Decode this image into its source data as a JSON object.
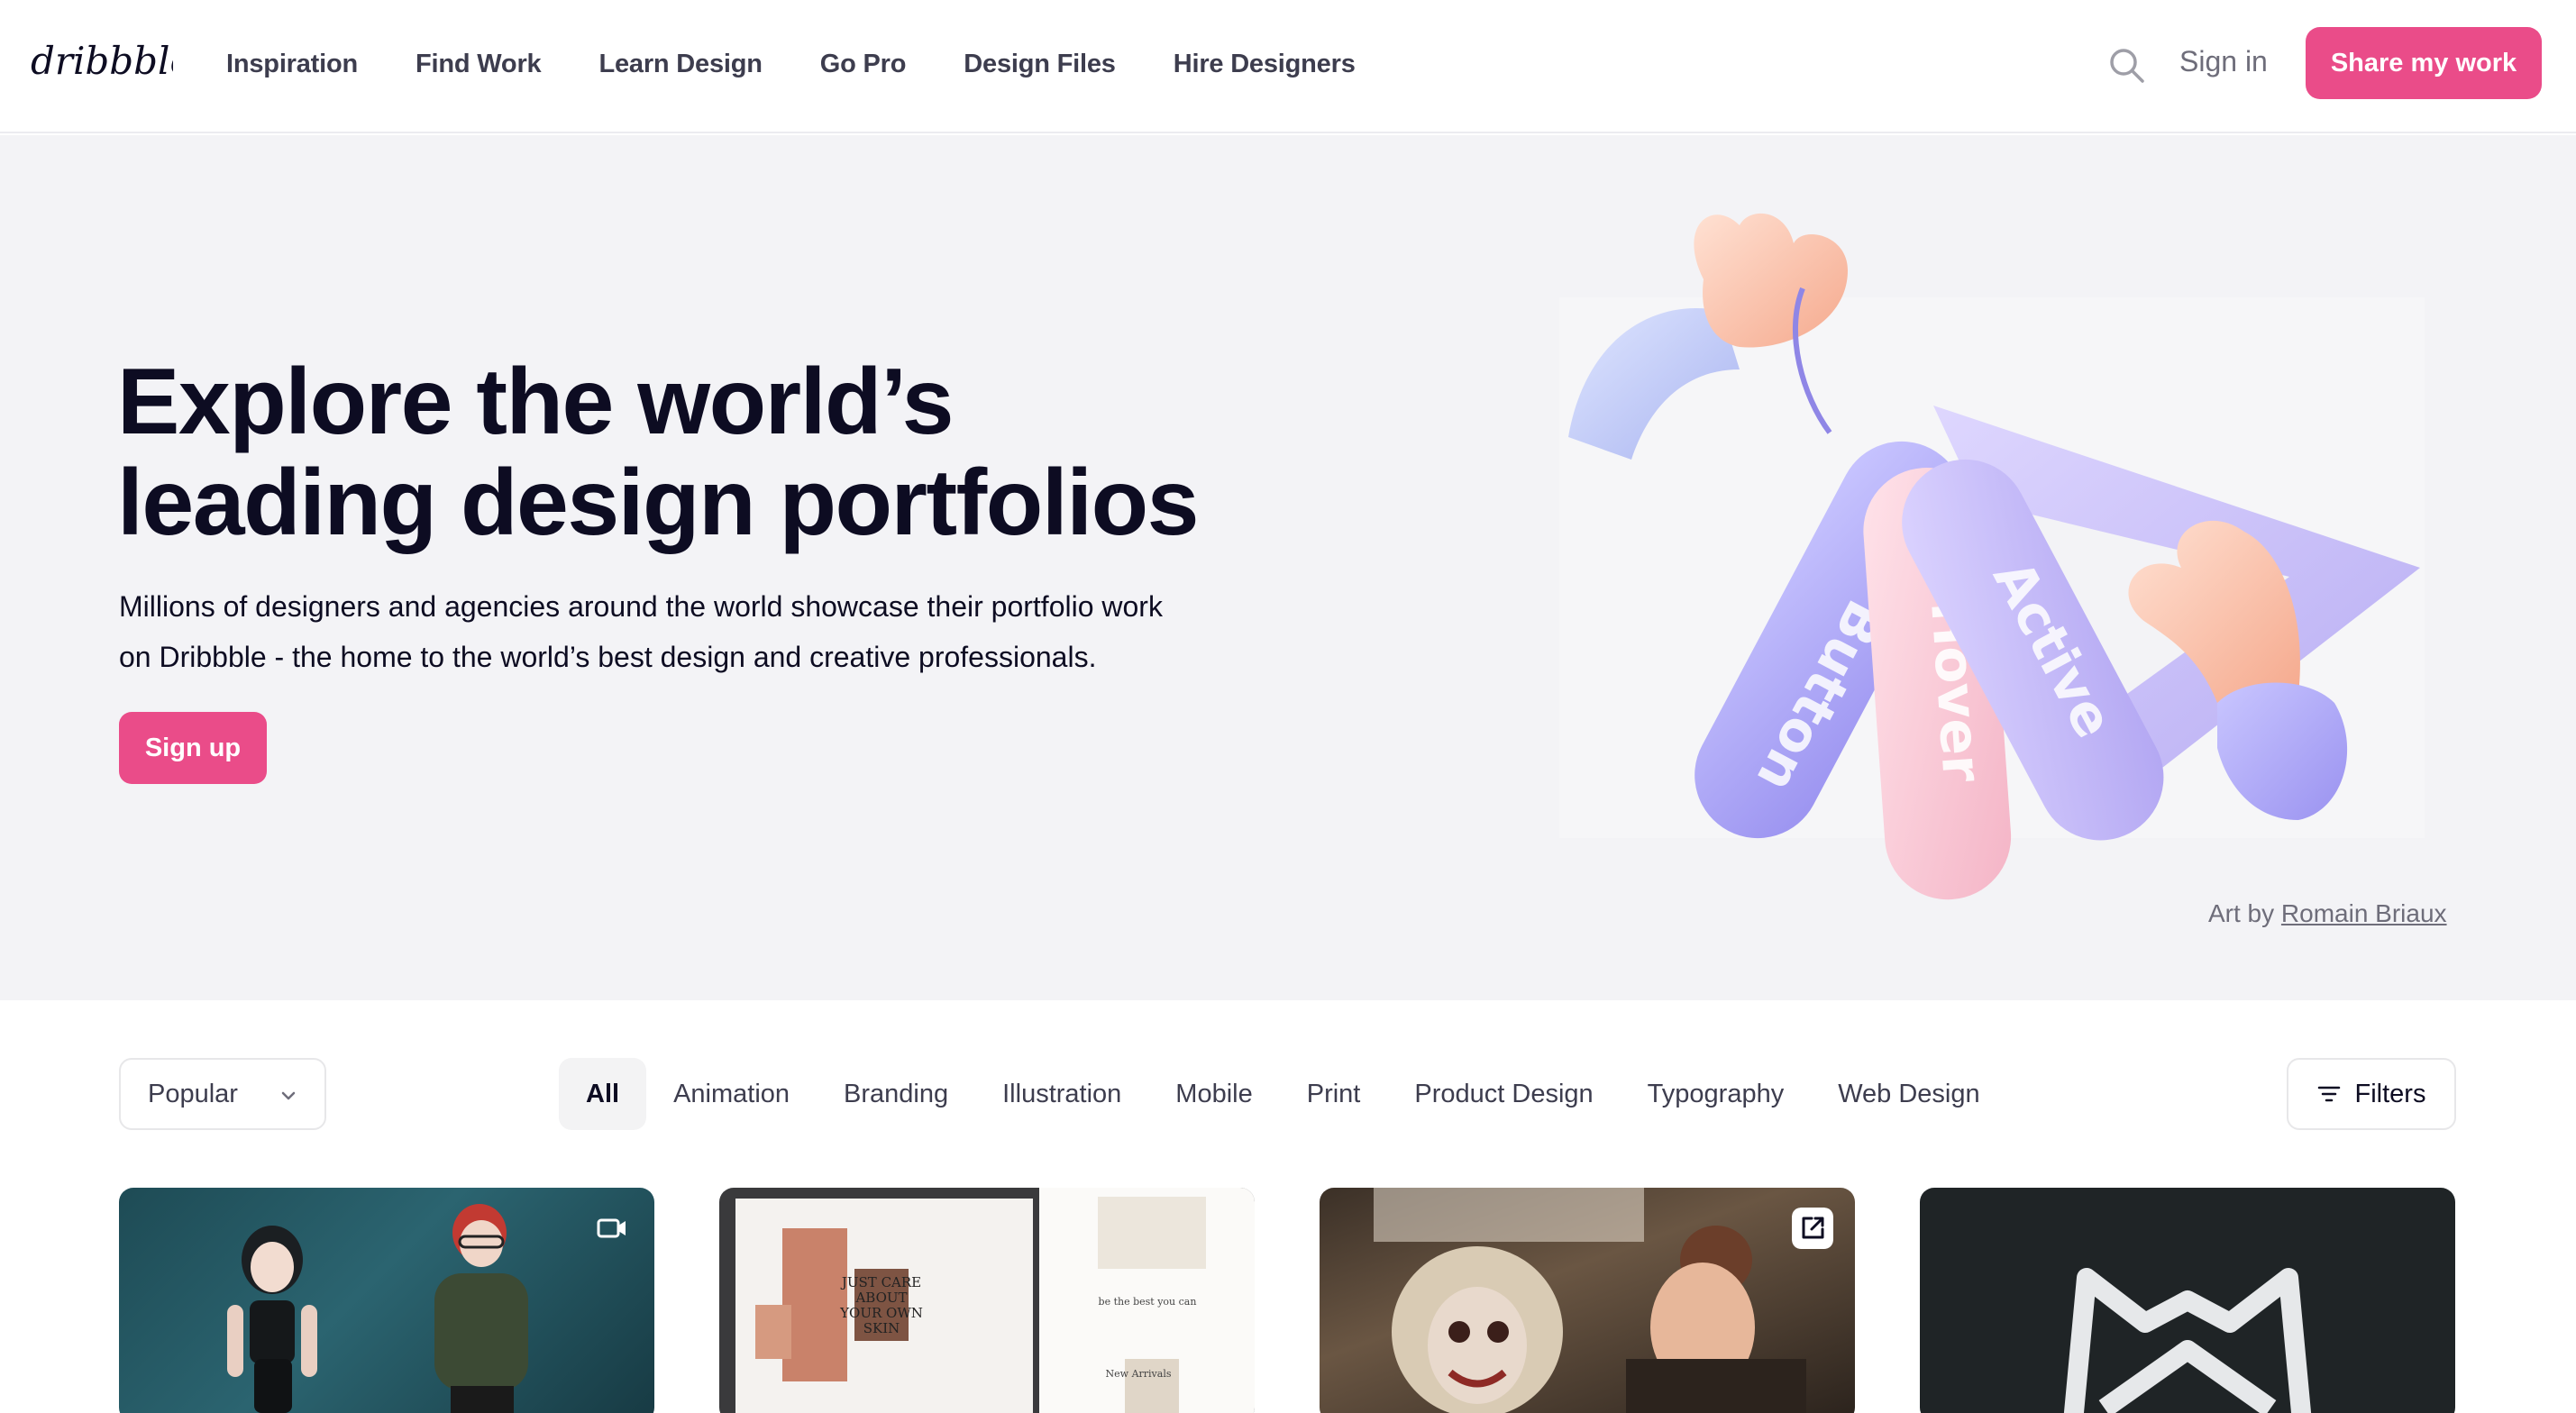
{
  "brand": {
    "logo_text": "dribbble",
    "accent": "#ea4c89"
  },
  "nav": {
    "items": [
      {
        "label": "Inspiration"
      },
      {
        "label": "Find Work"
      },
      {
        "label": "Learn Design"
      },
      {
        "label": "Go Pro"
      },
      {
        "label": "Design Files"
      },
      {
        "label": "Hire Designers"
      }
    ],
    "search_icon": "search-icon",
    "sign_in": "Sign in",
    "share_button": "Share my work"
  },
  "hero": {
    "title_line1": "Explore the world’s",
    "title_line2": "leading design portfolios",
    "subtitle_line1": "Millions of designers and agencies around the world showcase their portfolio work",
    "subtitle_line2": "on Dribbble - the home to the world’s best design and creative professionals.",
    "signup_button": "Sign up",
    "art_labels": [
      "Button",
      "Hover",
      "Active"
    ],
    "credit_prefix": "Art by",
    "credit_author": "Romain Briaux"
  },
  "filters": {
    "sort_selected": "Popular",
    "categories": [
      {
        "label": "All",
        "active": true
      },
      {
        "label": "Animation"
      },
      {
        "label": "Branding"
      },
      {
        "label": "Illustration"
      },
      {
        "label": "Mobile"
      },
      {
        "label": "Print"
      },
      {
        "label": "Product Design"
      },
      {
        "label": "Typography"
      },
      {
        "label": "Web Design"
      }
    ],
    "filters_button": "Filters"
  },
  "shots": [
    {
      "badge": "video-icon"
    },
    {
      "text_lines": [
        "JUST CARE",
        "ABOUT",
        "YOUR OWN",
        "SKIN"
      ],
      "tagline": "be the best you can",
      "side_text": "New Arrivals"
    },
    {
      "badge": "external-link-icon"
    },
    {
      "badge": ""
    }
  ]
}
